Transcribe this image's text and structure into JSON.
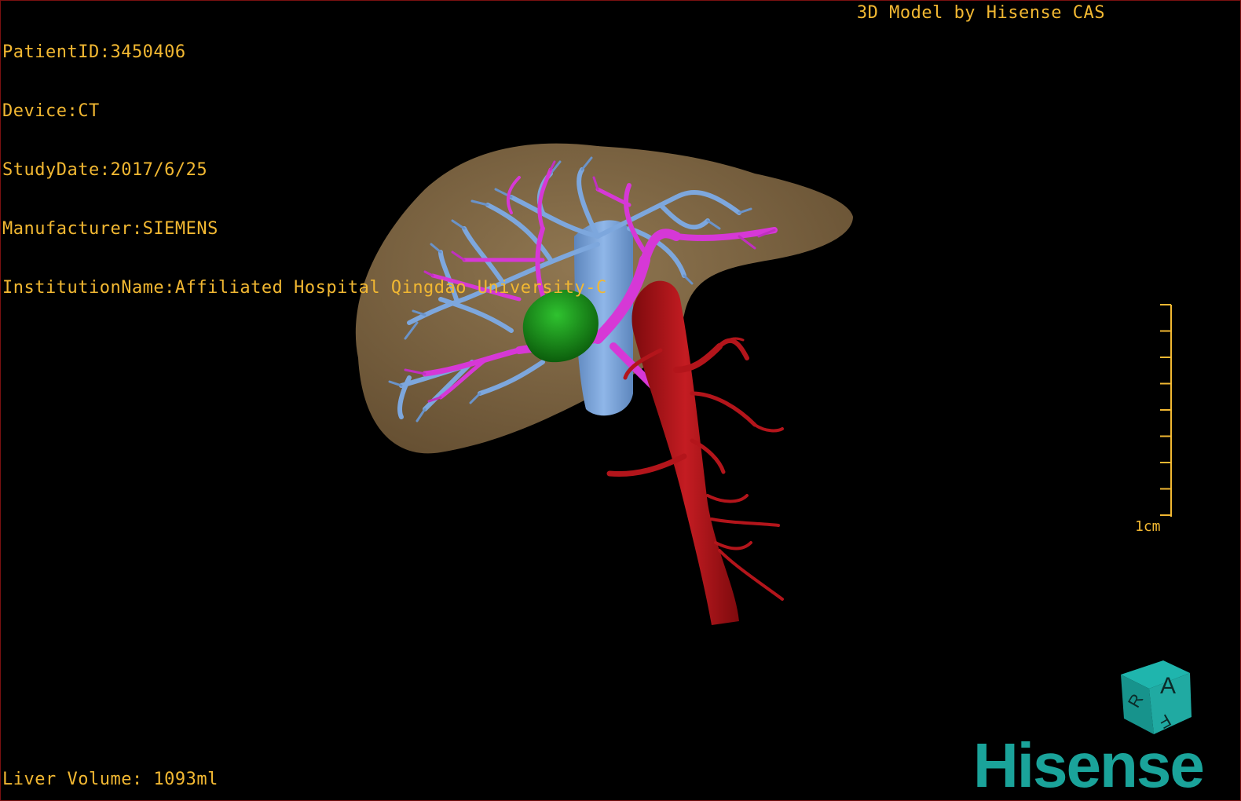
{
  "overlay": {
    "patient_id": "PatientID:3450406",
    "device": "Device:CT",
    "study_date": "StudyDate:2017/6/25",
    "manufacturer": "Manufacturer:SIEMENS",
    "institution": "InstitutionName:Affiliated Hospital Qingdao University-C",
    "model_credit": "3D Model by Hisense CAS",
    "liver_volume": "Liver Volume: 1093ml"
  },
  "scale": {
    "label": "1cm",
    "ticks": 9
  },
  "orientation_cube": {
    "face_top": "A",
    "face_left": "R",
    "face_bottom": "F"
  },
  "brand": {
    "logo_text": "Hisense",
    "color": "#1aa39a"
  },
  "colors": {
    "overlay_text": "#f2b832",
    "liver": "#8a6f4c",
    "hepatic_vein": "#7da7dd",
    "portal_vein": "#d638d6",
    "tumor": "#1a9a1a",
    "artery": "#b3151b"
  }
}
